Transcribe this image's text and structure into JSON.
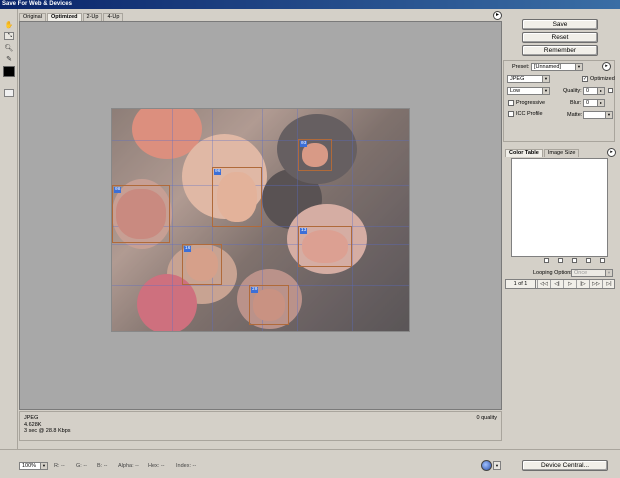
{
  "window": {
    "title": "Save For Web & Devices"
  },
  "tabs": [
    {
      "label": "Original"
    },
    {
      "label": "Optimized"
    },
    {
      "label": "2-Up"
    },
    {
      "label": "4-Up"
    }
  ],
  "tools": [
    "hand-icon",
    "slice-select-icon",
    "zoom-icon",
    "eyedropper-icon",
    "eyedropper-color-swatch",
    "toggle-slices-icon"
  ],
  "slices": [
    {
      "id": "03",
      "label": "03"
    },
    {
      "id": "06",
      "label": "06"
    },
    {
      "id": "08",
      "label": "08"
    },
    {
      "id": "13",
      "label": "13"
    },
    {
      "id": "16",
      "label": "16"
    },
    {
      "id": "20",
      "label": "20"
    }
  ],
  "info": {
    "format": "JPEG",
    "size": "4.628K",
    "time": "3 sec @ 28.8 Kbps",
    "quality": "0 quality"
  },
  "status": {
    "zoom": "100%",
    "r": "R: --",
    "g": "G: --",
    "b": "B: --",
    "alpha": "Alpha: --",
    "hex": "Hex: --",
    "index": "Index: --"
  },
  "buttons": {
    "save": "Save",
    "reset": "Reset",
    "remember": "Remember",
    "device_central": "Device Central..."
  },
  "settings": {
    "preset_label": "Preset:",
    "preset_value": "[Unnamed]",
    "format_value": "JPEG",
    "optimized_label": "Optimized",
    "optimized_checked": true,
    "quality_level": "Low",
    "quality_label": "Quality:",
    "quality_value": "0",
    "progressive_label": "Progressive",
    "blur_label": "Blur:",
    "blur_value": "0",
    "icc_label": "ICC Profile",
    "matte_label": "Matte:"
  },
  "color_table": {
    "tabs": [
      "Color Table",
      "Image Size"
    ],
    "looping_label": "Looping Options:",
    "looping_value": "Once",
    "frame_count": "1 of 1"
  },
  "colors": {
    "window_bg": "#d4d0c8",
    "canvas_bg": "#a8a8a8",
    "slice_tag": "#3b6fd8",
    "slice_border": "#b06a3a"
  }
}
